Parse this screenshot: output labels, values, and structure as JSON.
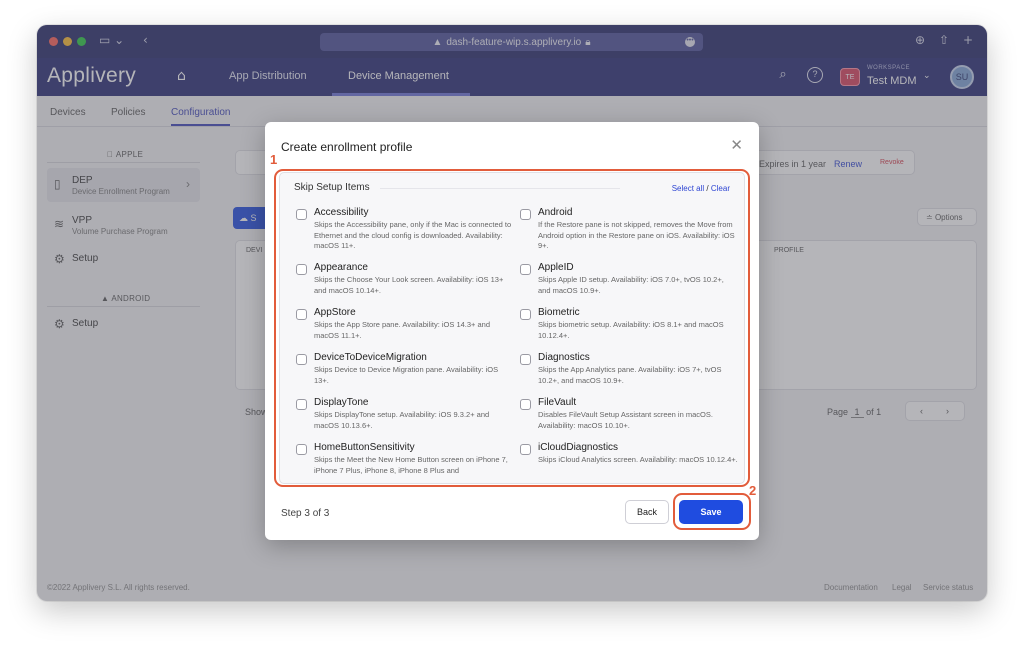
{
  "browser": {
    "url": "dash-feature-wip.s.applivery.io"
  },
  "app": {
    "logo": "Applivery",
    "nav": [
      "App Distribution",
      "Device Management"
    ],
    "workspace_label": "WORKSPACE",
    "workspace_badge": "TE",
    "workspace_name": "Test MDM",
    "avatar": "SU"
  },
  "subtabs": [
    "Devices",
    "Policies",
    "Configuration"
  ],
  "sidebar": {
    "apple_header": "APPLE",
    "android_header": "ANDROID",
    "items": [
      {
        "title": "DEP",
        "subtitle": "Device Enrollment Program"
      },
      {
        "title": "VPP",
        "subtitle": "Volume Purchase Program"
      },
      {
        "title": "Setup"
      },
      {
        "title": "Setup"
      }
    ]
  },
  "background": {
    "expires": "Expires in 1 year",
    "renew": "Renew",
    "revoke": "Revoke",
    "options": "Options",
    "col_profile": "PROFILE",
    "col_devi": "DEVI",
    "btn_s": "S",
    "show": "Show",
    "page_label": "Page",
    "page_num": "1",
    "page_of": "of 1"
  },
  "footer": {
    "copyright": "©2022 Applivery S.L. All rights reserved.",
    "links": [
      "Documentation",
      "Legal",
      "Service status"
    ]
  },
  "modal": {
    "title": "Create enrollment profile",
    "panel_title": "Skip Setup Items",
    "select_all": "Select all",
    "separator": "/",
    "clear": "Clear",
    "items": [
      {
        "name": "Accessibility",
        "desc": "Skips the Accessibility pane, only if the Mac is connected to Ethernet and the cloud config is downloaded. Availability: macOS 11+."
      },
      {
        "name": "Android",
        "desc": "If the Restore pane is not skipped, removes the Move from Android option in the Restore pane on iOS. Availability: iOS 9+."
      },
      {
        "name": "Appearance",
        "desc": "Skips the Choose Your Look screen. Availability: iOS 13+ and macOS 10.14+."
      },
      {
        "name": "AppleID",
        "desc": "Skips Apple ID setup. Availability: iOS 7.0+, tvOS 10.2+, and macOS 10.9+."
      },
      {
        "name": "AppStore",
        "desc": "Skips the App Store pane. Availability: iOS 14.3+ and macOS 11.1+."
      },
      {
        "name": "Biometric",
        "desc": "Skips biometric setup. Availability: iOS 8.1+ and macOS 10.12.4+."
      },
      {
        "name": "DeviceToDeviceMigration",
        "desc": "Skips Device to Device Migration pane. Availability: iOS 13+."
      },
      {
        "name": "Diagnostics",
        "desc": "Skips the App Analytics pane. Availability: iOS 7+, tvOS 10.2+, and macOS 10.9+."
      },
      {
        "name": "DisplayTone",
        "desc": "Skips DisplayTone setup. Availability: iOS 9.3.2+ and macOS 10.13.6+."
      },
      {
        "name": "FileVault",
        "desc": "Disables FileVault Setup Assistant screen in macOS. Availability: macOS 10.10+."
      },
      {
        "name": "HomeButtonSensitivity",
        "desc": "Skips the Meet the New Home Button screen on iPhone 7, iPhone 7 Plus, iPhone 8, iPhone 8 Plus and"
      },
      {
        "name": "iCloudDiagnostics",
        "desc": "Skips iCloud Analytics screen. Availability: macOS 10.12.4+."
      }
    ],
    "step": "Step 3 of 3",
    "back": "Back",
    "save": "Save"
  },
  "callouts": [
    "1",
    "2"
  ],
  "colors": {
    "header": "#272b74",
    "primary": "#1f4ce0",
    "callout": "#e25c3b"
  }
}
